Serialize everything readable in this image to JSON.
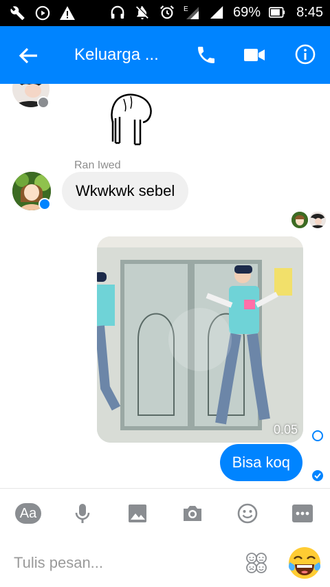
{
  "status_bar": {
    "battery": "69%",
    "time": "8:45"
  },
  "header": {
    "title": "Keluarga ..."
  },
  "chat": {
    "sender_name": "Ran Iwed",
    "incoming_message": "Wkwkwk sebel",
    "video_duration": "0.05",
    "outgoing_message": "Bisa koq"
  },
  "composer": {
    "aa_label": "Aa",
    "placeholder": "Tulis pesan..."
  },
  "colors": {
    "accent": "#0084ff",
    "bubble_in": "#f0f0f0",
    "toolbar_icon": "#8a8d91"
  },
  "icons": [
    "wrench-icon",
    "play-circle-icon",
    "warning-icon",
    "headphones-icon",
    "mute-icon",
    "alarm-icon",
    "signal-e-icon",
    "signal-icon",
    "battery-icon",
    "back-arrow-icon",
    "phone-icon",
    "video-camera-icon",
    "info-icon",
    "microphone-icon",
    "image-icon",
    "camera-icon",
    "smiley-icon",
    "more-icon",
    "sticker-icon",
    "laughing-emoji-icon"
  ]
}
